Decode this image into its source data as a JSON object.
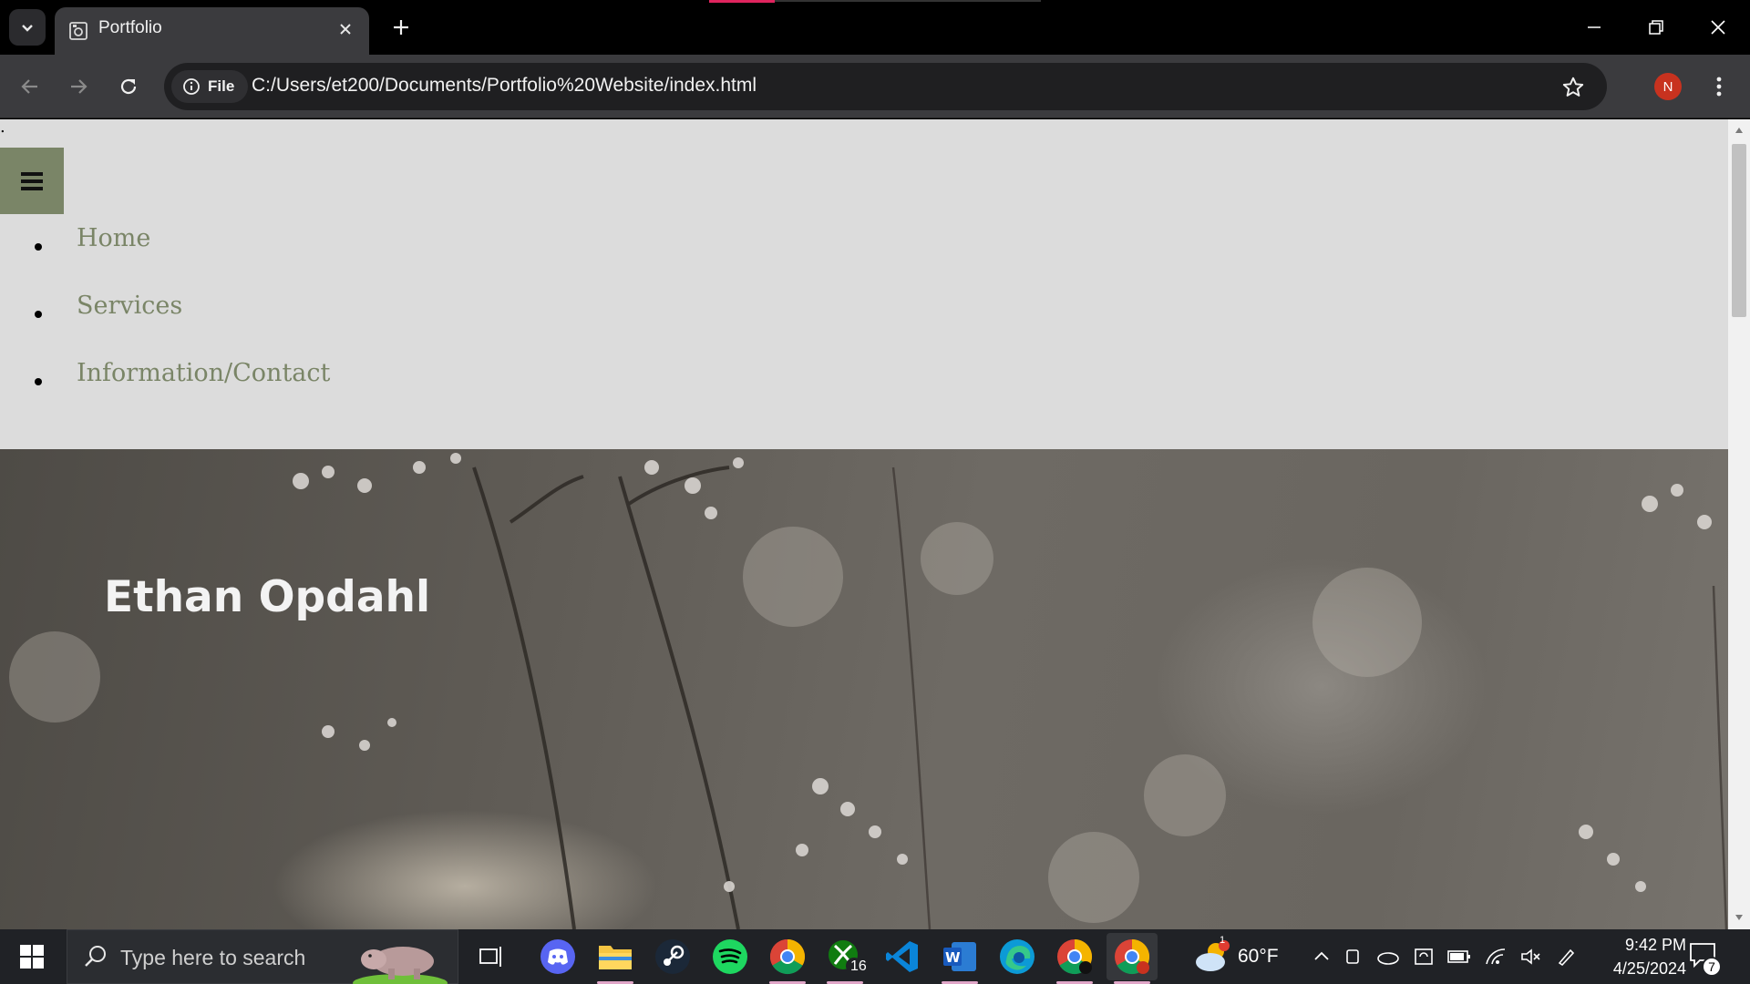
{
  "browser": {
    "tab_title": "Portfolio",
    "address_chip": "File",
    "url": "C:/Users/et200/Documents/Portfolio%20Website/index.html",
    "profile_initial": "N"
  },
  "page": {
    "stray_text": ".",
    "nav": {
      "items": [
        {
          "label": "Home"
        },
        {
          "label": "Services"
        },
        {
          "label": "Information/Contact"
        }
      ]
    },
    "hero": {
      "title": "Ethan Opdahl"
    }
  },
  "taskbar": {
    "search_placeholder": "Type here to search",
    "xbox_badge": "16",
    "weather_badge": "1",
    "weather": "60°F",
    "time": "9:42 PM",
    "date": "4/25/2024",
    "notification_count": "7"
  },
  "colors": {
    "accent_green": "#7a8567",
    "page_bg": "#dcdcdc",
    "browser_bg": "#3b3b3e"
  }
}
